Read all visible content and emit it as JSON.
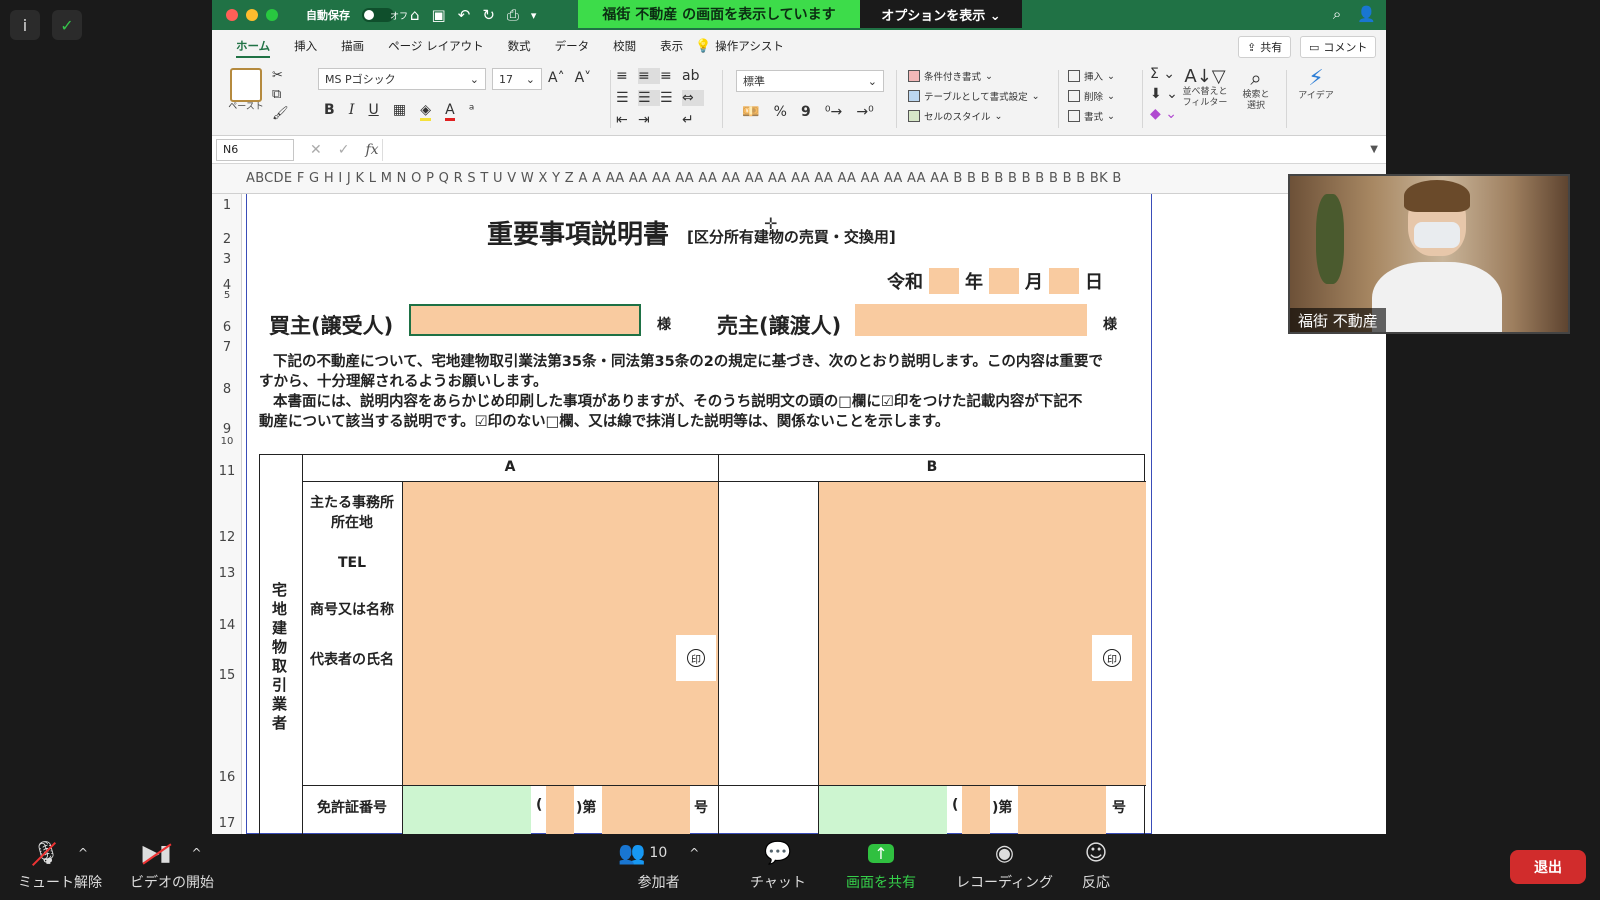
{
  "zoom_top_icons": {
    "info": "i",
    "security": "✓"
  },
  "excel": {
    "titlebar": {
      "autosave_label": "自動保存",
      "autosave_state": "オフ",
      "share_banner": "福街 不動産 の画面を表示しています",
      "options_label": "オプションを表示 ⌄"
    },
    "tabs": [
      "ホーム",
      "挿入",
      "描画",
      "ページ レイアウト",
      "数式",
      "データ",
      "校閲",
      "表示",
      "操作アシスト"
    ],
    "share_button": "共有",
    "comment_button": "コメント",
    "ribbon": {
      "paste_label": "ペースト",
      "font_name": "MS Pゴシック",
      "font_size": "17",
      "number_format": "標準",
      "conditional_format": "条件付き書式",
      "table_format": "テーブルとして書式設定",
      "cell_style": "セルのスタイル",
      "insert": "挿入",
      "delete": "削除",
      "format": "書式",
      "sort_filter": "並べ替えと\nフィルター",
      "find_select": "検索と\n選択",
      "ideas": "アイデア",
      "bold": "B",
      "italic": "I",
      "underline": "U",
      "percent": "%",
      "comma": "9"
    },
    "formula_bar": {
      "name_box": "N6",
      "fx": "fx",
      "cancel": "✕",
      "enter": "✓"
    },
    "column_headers": "ABCDE F G H I J K L M N O P Q R S T U V W X Y Z A A AA AA AA AA AA AA AA AA AA AA AA AA AA AA AA B B B B B B B B B B BK B",
    "row_numbers": [
      "1",
      "2",
      "3",
      "4",
      "5",
      "6",
      "7",
      "8",
      "9",
      "10",
      "11",
      "12",
      "13",
      "14",
      "15",
      "16",
      "17"
    ],
    "doc": {
      "title": "重要事項説明書",
      "subtitle": "[区分所有建物の売買・交換用]",
      "era": "令和",
      "year": "年",
      "month": "月",
      "day": "日",
      "buyer_label": "買主(譲受人)",
      "sama": "様",
      "seller_label": "売主(譲渡人)",
      "para1_line1": "下記の不動産について、宅地建物取引業法第35条・同法第35条の2の規定に基づき、次のとおり説明します。この内容は重要で",
      "para1_line2": "すから、十分理解されるようお願いします。",
      "para2_line1": "本書面には、説明内容をあらかじめ印刷した事項がありますが、そのうち説明文の頭の□欄に☑印をつけた記載内容が下記不",
      "para2_line2": "動産について該当する説明です。☑印のない□欄、又は線で抹消した説明等は、関係ないことを示します。",
      "table": {
        "vertical_label": "宅地建物取引業者",
        "col_a": "A",
        "col_b": "B",
        "office_l1": "主たる事務所",
        "office_l2": "所在地",
        "tel": "TEL",
        "trade_name": "商号又は名称",
        "rep_name": "代表者の氏名",
        "seal": "印",
        "license": "免許証番号",
        "paren_open": "(",
        "paren_close_dai": ")第",
        "go": "号"
      }
    }
  },
  "video": {
    "participant_name": "福街 不動産"
  },
  "bottombar": {
    "mute": "ミュート解除",
    "video": "ビデオの開始",
    "participants": "参加者",
    "participants_count": "10",
    "chat": "チャット",
    "share": "画面を共有",
    "record": "レコーディング",
    "reactions": "反応",
    "leave": "退出"
  }
}
